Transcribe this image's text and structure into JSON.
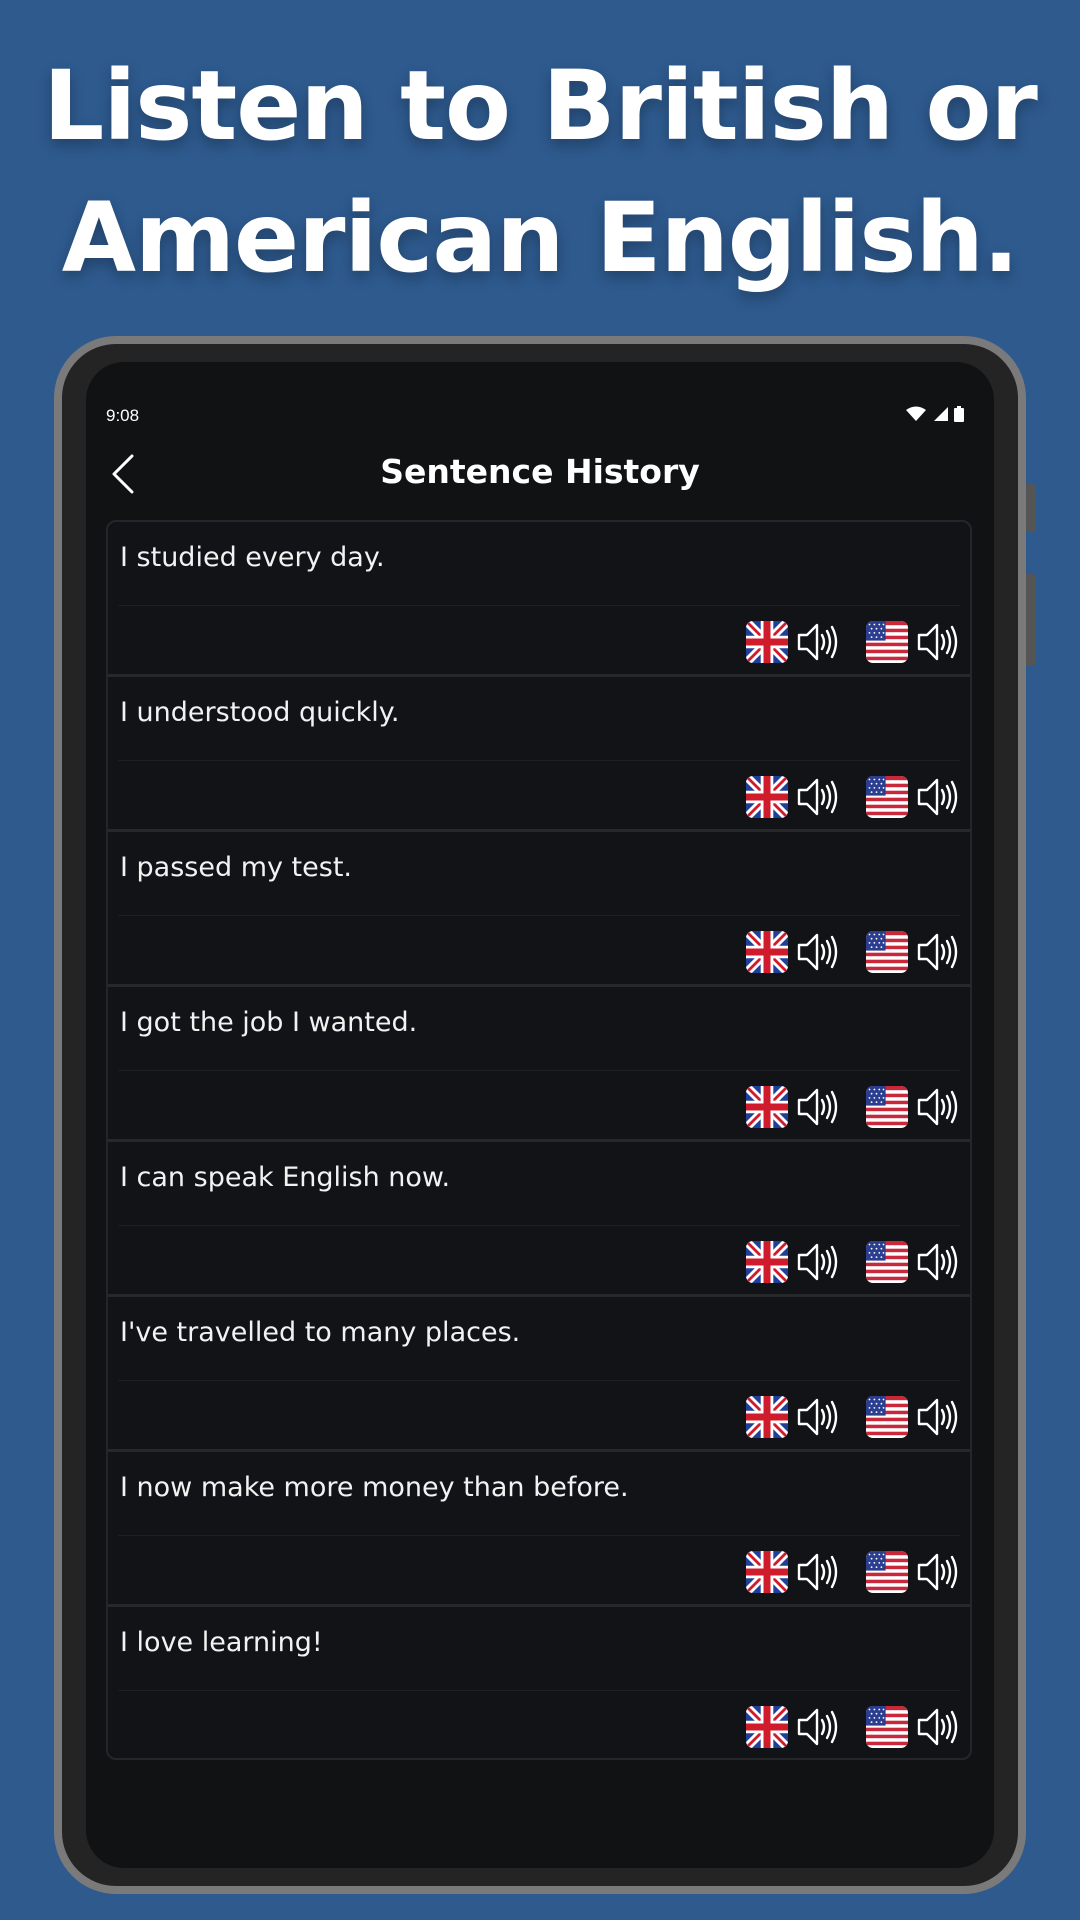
{
  "headline": {
    "line1": "Listen to British or",
    "line2": "American English."
  },
  "status_bar": {
    "time": "9:08",
    "icons": [
      "wifi-icon",
      "cell-signal-icon",
      "battery-icon"
    ]
  },
  "header": {
    "title": "Sentence History",
    "back_icon": "chevron-left-icon"
  },
  "sentences": [
    {
      "text": "I studied every day."
    },
    {
      "text": "I understood quickly."
    },
    {
      "text": "I passed my test."
    },
    {
      "text": "I got the job I wanted."
    },
    {
      "text": "I can speak English now."
    },
    {
      "text": "I've travelled to many places."
    },
    {
      "text": "I now make more money than before."
    },
    {
      "text": "I love learning!"
    }
  ],
  "audio_options": [
    "uk-flag-icon",
    "us-flag-icon",
    "speaker-icon"
  ],
  "colors": {
    "background": "#2e5a8e",
    "device_frame": "#7a7a7a",
    "screen": "#111214",
    "text": "#ffffff"
  }
}
